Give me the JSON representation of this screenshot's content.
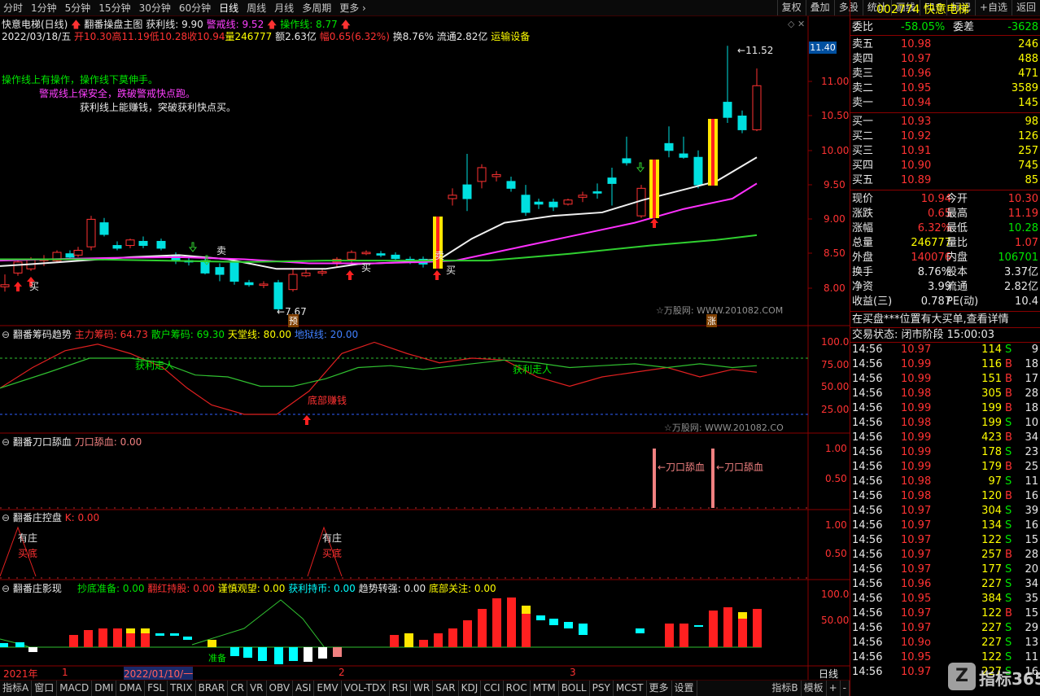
{
  "periods": [
    "分时",
    "1分钟",
    "5分钟",
    "15分钟",
    "30分钟",
    "60分钟",
    "日线",
    "周线",
    "月线",
    "多周期",
    "更多"
  ],
  "active_period": "日线",
  "toolbar_buttons": [
    "复权",
    "叠加",
    "多股",
    "统计",
    "画线",
    "F10",
    "标记",
    "+自选",
    "返回"
  ],
  "stock": {
    "name": "快意电梯(日线)",
    "code": "002774",
    "fullname": "快意电梯"
  },
  "main_title": "翻番操盘主图",
  "main_lines": {
    "huoli": "获利线: 9.90",
    "jingjie": "警戒线: 9.52",
    "caozuo": "操作线: 8.77"
  },
  "quote_line": {
    "date": "2022/03/18/五",
    "open": "开10.30",
    "high": "高11.19",
    "low": "低10.28",
    "close": "收10.94",
    "vol": "量246777",
    "amount": "额2.63亿",
    "change": "幅0.65(6.32%)",
    "turnover": "换8.76%",
    "float": "流通2.82亿",
    "sector": "运输设备"
  },
  "annotations": {
    "line1": "操作线上有操作，操作线下莫伸手。",
    "line2": "警戒线上保安全，跌破警戒快点跑。",
    "line3": "获利线上能赚钱，突破获利快点买。"
  },
  "price_axis": {
    "labels": [
      "11.00",
      "10.50",
      "10.00",
      "9.50",
      "9.00",
      "8.50",
      "8.00"
    ],
    "current": "11.40",
    "high_mark": "11.52",
    "low_mark": "7.67"
  },
  "markers": {
    "buy": "买",
    "sell": "卖",
    "warn": "预",
    "rise": "涨"
  },
  "watermark1": "☆万股网: WWW.201082.COM",
  "watermark2": "☆万股网: WWW.201082.CO",
  "ind1": {
    "title": "翻番筹码趋势",
    "zhuli": "主力筹码: 64.73",
    "sanhu": "散户筹码: 69.30",
    "tiantang": "天堂线: 80.00",
    "diyu": "地狱线: 20.00",
    "axis": [
      "100.0",
      "75.00",
      "50.00",
      "25.00"
    ],
    "label_huoli": "获利走人",
    "label_dibu": "底部赚钱",
    "label_huoli2": "获利走人"
  },
  "ind2": {
    "title": "翻番刀口舔血",
    "value": "刀口舔血: 0.00",
    "axis": [
      "1.00",
      "0.50"
    ],
    "label": "←刀口舔血"
  },
  "ind3": {
    "title": "翻番庄控盘",
    "value": "K: 0.00",
    "axis": [
      "1.00",
      "0.50"
    ],
    "label_you": "有庄",
    "label_mai": "买底"
  },
  "ind4": {
    "title": "翻番庄影现",
    "chaodi": "抄底准备: 0.00",
    "fanhong": "翻红持股: 0.00",
    "jinshen": "谨慎观望: 0.00",
    "huoli": "获利持币: 0.00",
    "qushi": "趋势转强: 0.00",
    "dibu": "底部关注: 0.00",
    "axis": [
      "100.0",
      "50.00"
    ],
    "label_zhun": "准备"
  },
  "time_axis": {
    "y2021": "2021年",
    "m1": "1",
    "date": "2022/01/10/一",
    "m2": "2",
    "m3": "3",
    "period": "日线"
  },
  "bottom_tabs": [
    "指标A",
    "窗口",
    "MACD",
    "DMI",
    "DMA",
    "FSL",
    "TRIX",
    "BRAR",
    "CR",
    "VR",
    "OBV",
    "ASI",
    "EMV",
    "VOL-TDX",
    "RSI",
    "WR",
    "SAR",
    "KDJ",
    "CCI",
    "ROC",
    "MTM",
    "BOLL",
    "PSY",
    "MCST",
    "更多",
    "设置"
  ],
  "bottom_right": [
    "指标B",
    "模板",
    "+",
    "-"
  ],
  "quote": {
    "weibi_label": "委比",
    "weibi": "-58.05%",
    "weicha_label": "委差",
    "weicha": "-3628",
    "asks": [
      [
        "卖五",
        "10.98",
        "246"
      ],
      [
        "卖四",
        "10.97",
        "488"
      ],
      [
        "卖三",
        "10.96",
        "471"
      ],
      [
        "卖二",
        "10.95",
        "3589"
      ],
      [
        "卖一",
        "10.94",
        "145"
      ]
    ],
    "bids": [
      [
        "买一",
        "10.93",
        "98"
      ],
      [
        "买二",
        "10.92",
        "126"
      ],
      [
        "买三",
        "10.91",
        "257"
      ],
      [
        "买四",
        "10.90",
        "745"
      ],
      [
        "买五",
        "10.89",
        "85"
      ]
    ],
    "stats": [
      [
        "现价",
        "10.94",
        "今开",
        "10.30"
      ],
      [
        "涨跌",
        "0.65",
        "最高",
        "11.19"
      ],
      [
        "涨幅",
        "6.32%",
        "最低",
        "10.28"
      ],
      [
        "总量",
        "246777",
        "量比",
        "1.07"
      ],
      [
        "外盘",
        "140076",
        "内盘",
        "106701"
      ],
      [
        "换手",
        "8.76%",
        "股本",
        "3.37亿"
      ],
      [
        "净资",
        "3.99",
        "流通",
        "2.82亿"
      ],
      [
        "收益(三)",
        "0.787",
        "PE(动)",
        "10.4"
      ]
    ],
    "alert": "在买盘***位置有大买单,查看详情",
    "status": "交易状态: 闭市阶段 15:00:03",
    "ticks": [
      [
        "14:56",
        "10.97",
        "114",
        "S",
        "9"
      ],
      [
        "14:56",
        "10.99",
        "116",
        "B",
        "18"
      ],
      [
        "14:56",
        "10.99",
        "151",
        "B",
        "17"
      ],
      [
        "14:56",
        "10.98",
        "305",
        "B",
        "28"
      ],
      [
        "14:56",
        "10.99",
        "199",
        "B",
        "18"
      ],
      [
        "14:56",
        "10.98",
        "199",
        "S",
        "10"
      ],
      [
        "14:56",
        "10.99",
        "423",
        "B",
        "34"
      ],
      [
        "14:56",
        "10.99",
        "178",
        "S",
        "23"
      ],
      [
        "14:56",
        "10.99",
        "179",
        "B",
        "25"
      ],
      [
        "14:56",
        "10.98",
        "97",
        "S",
        "11"
      ],
      [
        "14:56",
        "10.98",
        "120",
        "B",
        "16"
      ],
      [
        "14:56",
        "10.97",
        "304",
        "S",
        "39"
      ],
      [
        "14:56",
        "10.97",
        "134",
        "S",
        "16"
      ],
      [
        "14:56",
        "10.97",
        "122",
        "S",
        "15"
      ],
      [
        "14:56",
        "10.97",
        "257",
        "B",
        "28"
      ],
      [
        "14:56",
        "10.97",
        "177",
        "S",
        "20"
      ],
      [
        "14:56",
        "10.96",
        "227",
        "S",
        "34"
      ],
      [
        "14:56",
        "10.95",
        "384",
        "S",
        "35"
      ],
      [
        "14:56",
        "10.97",
        "122",
        "B",
        "15"
      ],
      [
        "14:56",
        "10.97",
        "227",
        "S",
        "29"
      ],
      [
        "14:56",
        "10.9o",
        "227",
        "S",
        "13"
      ],
      [
        "14:56",
        "10.95",
        "122",
        "S",
        "11"
      ],
      [
        "14:56",
        "10.97",
        "227",
        "S",
        "16"
      ]
    ]
  },
  "logo": "指标365"
}
